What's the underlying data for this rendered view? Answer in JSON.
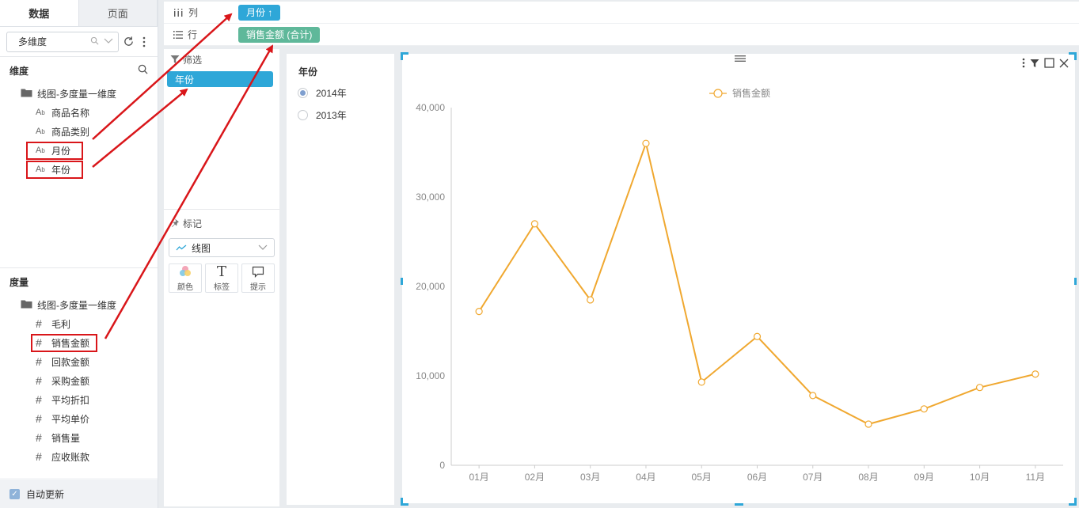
{
  "left_panel": {
    "tabs": [
      {
        "label": "数据",
        "active": true
      },
      {
        "label": "页面",
        "active": false
      }
    ],
    "dataset_select": {
      "value": "多维度"
    },
    "dimensions": {
      "title": "维度",
      "folder": "线图-多度量一维度",
      "fields": [
        {
          "label": "商品名称",
          "icon": "text-field-icon",
          "highlighted": false
        },
        {
          "label": "商品类别",
          "icon": "text-field-icon",
          "highlighted": false
        },
        {
          "label": "月份",
          "icon": "text-field-icon",
          "highlighted": true
        },
        {
          "label": "年份",
          "icon": "text-field-icon",
          "highlighted": true
        }
      ]
    },
    "measures": {
      "title": "度量",
      "folder": "线图-多度量一维度",
      "fields": [
        {
          "label": "毛利",
          "highlighted": false
        },
        {
          "label": "销售金额",
          "highlighted": true
        },
        {
          "label": "回款金额",
          "highlighted": false
        },
        {
          "label": "采购金额",
          "highlighted": false
        },
        {
          "label": "平均折扣",
          "highlighted": false
        },
        {
          "label": "平均单价",
          "highlighted": false
        },
        {
          "label": "销售量",
          "highlighted": false
        },
        {
          "label": "应收账款",
          "highlighted": false
        }
      ]
    },
    "auto_update": {
      "label": "自动更新",
      "checked": true
    }
  },
  "shelf": {
    "columns": {
      "label": "列",
      "pill": "月份 ↑"
    },
    "rows": {
      "label": "行",
      "pill": "销售金额 (合计)"
    }
  },
  "mid_panel": {
    "filter": {
      "title": "筛选",
      "chip": "年份"
    },
    "mark": {
      "title": "标记",
      "chart_type": "线图",
      "buttons": [
        {
          "label": "颜色",
          "icon": "color-palette-icon"
        },
        {
          "label": "标签",
          "icon": "text-label-icon"
        },
        {
          "label": "提示",
          "icon": "tooltip-icon"
        }
      ]
    }
  },
  "year_filter": {
    "title": "年份",
    "options": [
      {
        "label": "2014年",
        "selected": true
      },
      {
        "label": "2013年",
        "selected": false
      }
    ]
  },
  "colors": {
    "accent": "#2ea7d8",
    "series": "#f0a830",
    "highlight": "#d9161a",
    "green_pill": "#5fb89a"
  },
  "chart_data": {
    "type": "line",
    "categories": [
      "01月",
      "02月",
      "03月",
      "04月",
      "05月",
      "06月",
      "07月",
      "08月",
      "09月",
      "10月",
      "11月"
    ],
    "series": [
      {
        "name": "销售金额",
        "values": [
          17200,
          27000,
          18500,
          36000,
          9300,
          14400,
          7800,
          4600,
          6300,
          8700,
          10200
        ]
      }
    ],
    "yticks": [
      "0",
      "10,000",
      "20,000",
      "30,000",
      "40,000"
    ],
    "ylim": [
      0,
      40000
    ],
    "grid": false,
    "legend": "top-center"
  }
}
